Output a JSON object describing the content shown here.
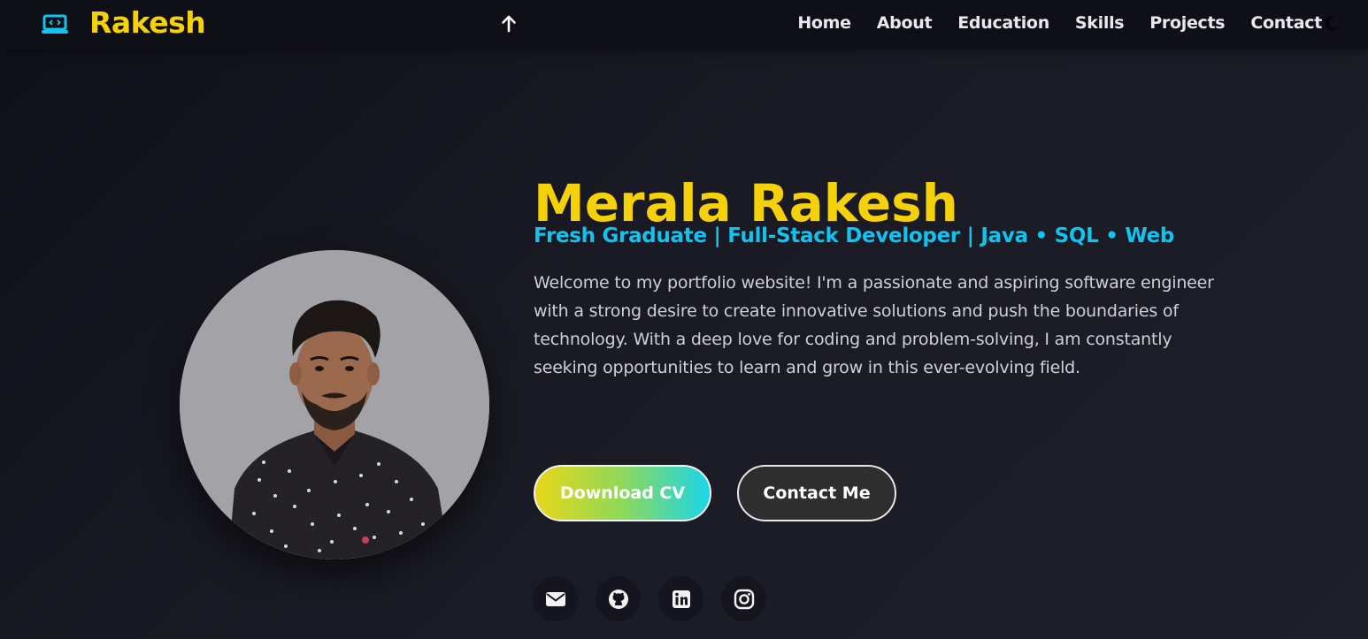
{
  "nav": {
    "logo_icon": "laptop-code-icon",
    "logo_text": "Rakesh",
    "scroll_top_icon": "arrow-up-icon",
    "theme_icon": "moon-icon",
    "links": [
      "Home",
      "About",
      "Education",
      "Skills",
      "Projects",
      "Contact"
    ]
  },
  "hero": {
    "name": "Merala Rakesh",
    "subtitle": "Fresh Graduate | Full-Stack Developer | Java • SQL • Web",
    "description": "Welcome to my portfolio website! I'm a passionate and aspiring software engineer with a strong desire to create innovative solutions and push the boundaries of technology. With a deep love for coding and problem-solving, I am constantly seeking opportunities to learn and grow in this ever-evolving field.",
    "download_label": "Download CV",
    "contact_label": "Contact Me"
  },
  "socials": [
    "envelope-icon",
    "github-icon",
    "linkedin-icon",
    "instagram-icon"
  ],
  "colors": {
    "accent_yellow": "#f5d10a",
    "accent_cyan": "#14c2f0",
    "background": "#1a1a24",
    "navbar": "#0f0f17"
  }
}
